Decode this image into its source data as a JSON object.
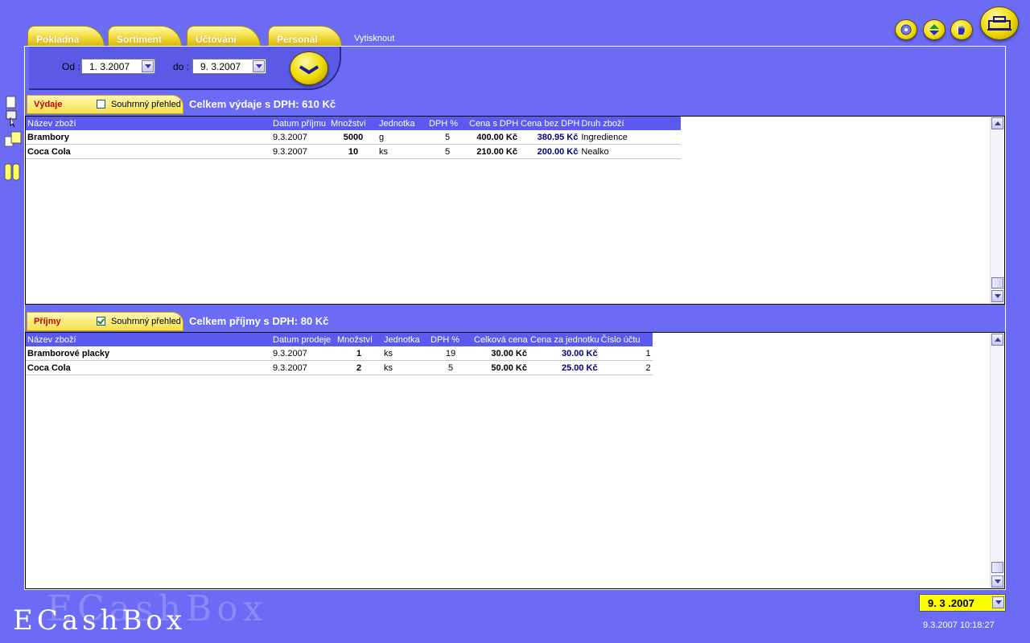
{
  "tabs": [
    {
      "label": "Pokladna"
    },
    {
      "label": "Sortiment"
    },
    {
      "label": "Účtování"
    },
    {
      "label": "Personál"
    }
  ],
  "print_label": "Vytisknout",
  "toolbar_icons": [
    "cd-icon",
    "up-down-arrows-icon",
    "hand-icon",
    "cash-register-icon"
  ],
  "filter": {
    "from_label": "Od :",
    "from_value": "1. 3.2007",
    "to_label": "do :",
    "to_value": "9. 3.2007"
  },
  "expenses": {
    "tab_label": "Výdaje",
    "summary_label": "Souhrnný přehled",
    "summary_checked": false,
    "total_text": "Celkem výdaje s DPH: 610 Kč",
    "columns": [
      "Název zboží",
      "Datum příjmu",
      "Množství",
      "Jednotka",
      "DPH %",
      "Cena s DPH",
      "Cena bez DPH",
      "Druh zboží"
    ],
    "rows": [
      [
        "Brambory",
        "9.3.2007",
        "5000",
        "g",
        "5",
        "400.00 Kč",
        "380.95 Kč",
        "Ingredience"
      ],
      [
        "Coca Cola",
        "9.3.2007",
        "10",
        "ks",
        "5",
        "210.00 Kč",
        "200.00 Kč",
        "Nealko"
      ]
    ]
  },
  "income": {
    "tab_label": "Příjmy",
    "summary_label": "Souhrnný přehled",
    "summary_checked": true,
    "total_text": "Celkem příjmy s DPH: 80 Kč",
    "columns": [
      "Název zboží",
      "Datum prodeje",
      "Množství",
      "Jednotka",
      "DPH %",
      "Celková cena",
      "Cena za jednotku",
      "Číslo účtu"
    ],
    "rows": [
      [
        "Bramborové placky",
        "9.3.2007",
        "1",
        "ks",
        "19",
        "30.00 Kč",
        "30.00 Kč",
        "1"
      ],
      [
        "Coca Cola",
        "9.3.2007",
        "2",
        "ks",
        "5",
        "50.00 Kč",
        "25.00 Kč",
        "2"
      ]
    ]
  },
  "logo_text": "ECashBox",
  "current_date": "9. 3 .2007",
  "clock": "9.3.2007 10:18:27"
}
